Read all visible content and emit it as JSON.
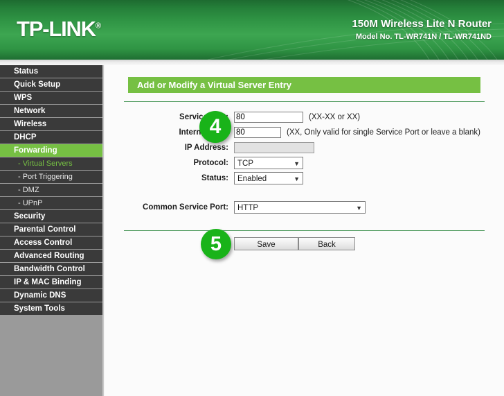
{
  "header": {
    "logo_text": "TP-LINK",
    "logo_mark": "®",
    "model_title": "150M Wireless Lite N Router",
    "model_sub": "Model No. TL-WR741N / TL-WR741ND"
  },
  "sidebar": {
    "items": [
      {
        "label": "Status",
        "type": "main",
        "state": "normal"
      },
      {
        "label": "Quick Setup",
        "type": "main",
        "state": "normal"
      },
      {
        "label": "WPS",
        "type": "main",
        "state": "normal"
      },
      {
        "label": "Network",
        "type": "main",
        "state": "normal"
      },
      {
        "label": "Wireless",
        "type": "main",
        "state": "normal"
      },
      {
        "label": "DHCP",
        "type": "main",
        "state": "normal"
      },
      {
        "label": "Forwarding",
        "type": "main",
        "state": "active"
      },
      {
        "label": "- Virtual Servers",
        "type": "sub",
        "state": "current"
      },
      {
        "label": "- Port Triggering",
        "type": "sub",
        "state": "normal"
      },
      {
        "label": "- DMZ",
        "type": "sub",
        "state": "normal"
      },
      {
        "label": "- UPnP",
        "type": "sub",
        "state": "normal"
      },
      {
        "label": "Security",
        "type": "main",
        "state": "normal"
      },
      {
        "label": "Parental Control",
        "type": "main",
        "state": "normal"
      },
      {
        "label": "Access Control",
        "type": "main",
        "state": "normal"
      },
      {
        "label": "Advanced Routing",
        "type": "main",
        "state": "normal"
      },
      {
        "label": "Bandwidth Control",
        "type": "main",
        "state": "normal"
      },
      {
        "label": "IP & MAC Binding",
        "type": "main",
        "state": "normal"
      },
      {
        "label": "Dynamic DNS",
        "type": "main",
        "state": "normal"
      },
      {
        "label": "System Tools",
        "type": "main",
        "state": "normal"
      }
    ]
  },
  "main": {
    "title": "Add or Modify a Virtual Server Entry",
    "fields": {
      "service_port": {
        "label": "Service Port:",
        "value": "80",
        "hint": "(XX-XX or XX)"
      },
      "internal_port": {
        "label": "Internal Port:",
        "value": "80",
        "hint": "(XX, Only valid for single Service Port or leave a blank)"
      },
      "ip_address": {
        "label": "IP Address:",
        "value": ""
      },
      "protocol": {
        "label": "Protocol:",
        "value": "TCP"
      },
      "status": {
        "label": "Status:",
        "value": "Enabled"
      },
      "common_service_port": {
        "label": "Common Service Port:",
        "value": "HTTP"
      }
    },
    "buttons": {
      "save": "Save",
      "back": "Back"
    }
  },
  "annotations": {
    "step_four": "4",
    "step_five": "5"
  },
  "colors": {
    "brand_green": "#76c043",
    "header_green": "#2f9444",
    "badge_green": "#19b319",
    "sidebar_dark": "#3a3a3a",
    "sidebar_filler": "#9a9a9a"
  }
}
